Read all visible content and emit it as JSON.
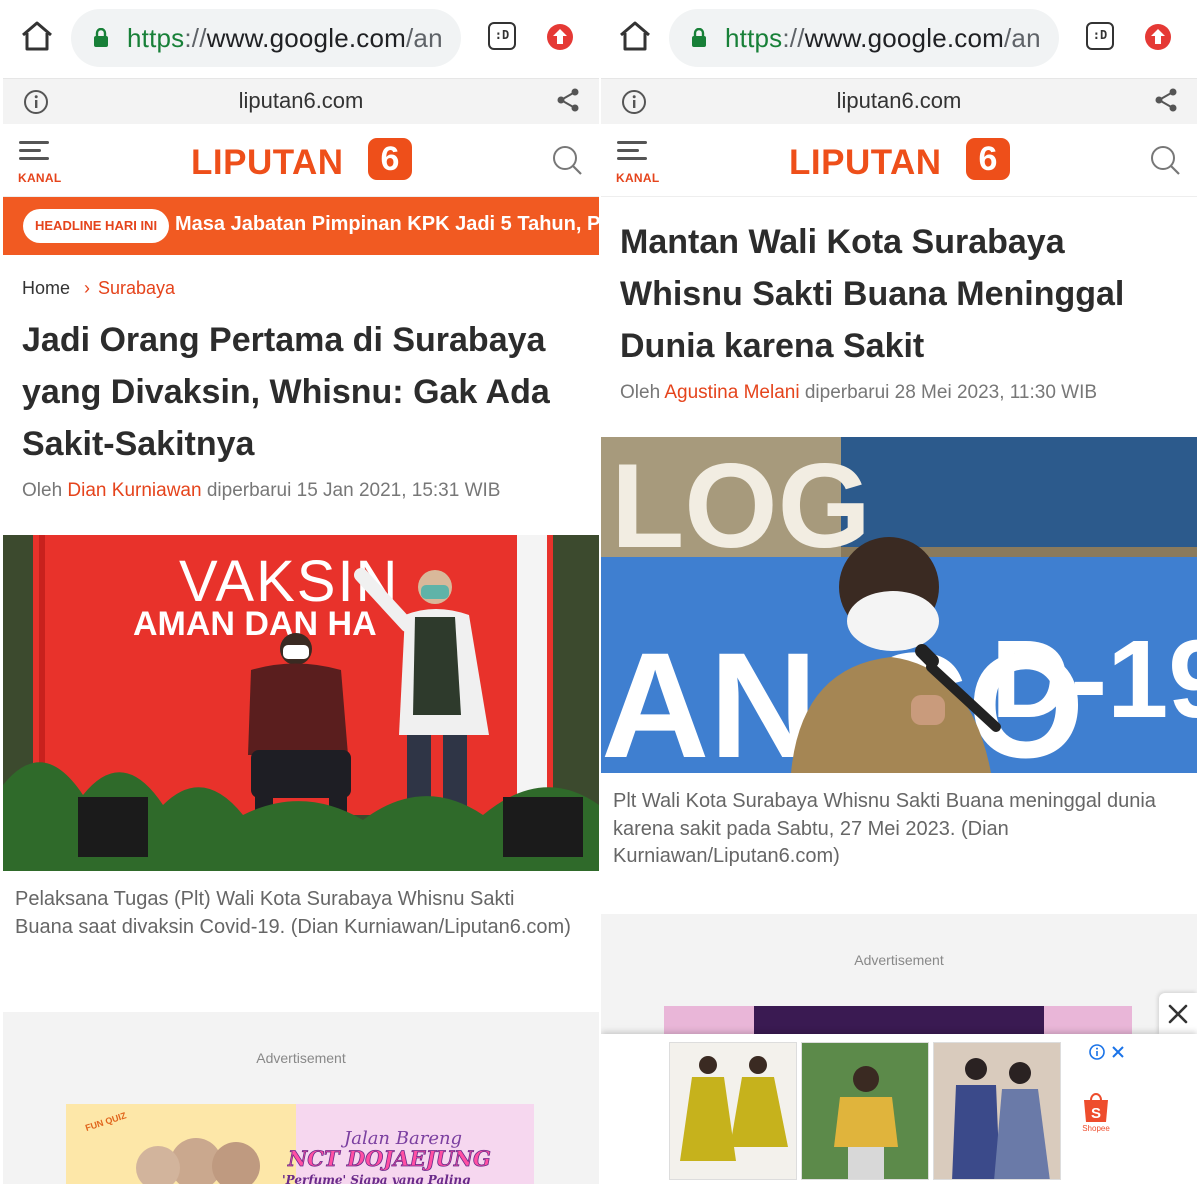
{
  "colors": {
    "brand": "#ee4f1a",
    "url_scheme": "#188038",
    "headline_strip": "#f15a22"
  },
  "left": {
    "browser": {
      "url_scheme": "https",
      "url_sep": "://",
      "url_host": "www.google.com",
      "url_rest": "/an",
      "tab_icon_label": ":D",
      "site_domain": "liputan6.com"
    },
    "header": {
      "menu_label": "KANAL",
      "logo_text": "LIPUTAN",
      "logo_badge": "6"
    },
    "headline": {
      "badge": "HEADLINE HARI INI",
      "text": "Masa Jabatan Pimpinan KPK Jadi 5 Tahun, P"
    },
    "breadcrumb": {
      "home": "Home",
      "separator": "›",
      "category": "Surabaya"
    },
    "article": {
      "title": "Jadi Orang Pertama di Surabaya yang Divaksin, Whisnu: Gak Ada Sakit-Sakitnya",
      "by_prefix": "Oleh",
      "author": "Dian Kurniawan",
      "updated": "diperbarui 15 Jan 2021, 15:31 WIB",
      "photo_banner_1": "VAKSIN",
      "photo_banner_2": "AMAN DAN HA",
      "caption": "Pelaksana Tugas (Plt) Wali Kota Surabaya Whisnu Sakti Buana saat divaksin Covid-19. (Dian Kurniawan/Liputan6.com)"
    },
    "ad": {
      "label": "Advertisement",
      "banner_line1": "Jalan Bareng",
      "banner_line2": "NCT DOJAEJUNG",
      "banner_line3": "'Perfume' Siapa yang Paling",
      "banner_badge": "FUN QUIZ"
    }
  },
  "right": {
    "browser": {
      "url_scheme": "https",
      "url_sep": "://",
      "url_host": "www.google.com",
      "url_rest": "/an",
      "tab_icon_label": ":D",
      "site_domain": "liputan6.com"
    },
    "header": {
      "menu_label": "KANAL",
      "logo_text": "LIPUTAN",
      "logo_badge": "6"
    },
    "article": {
      "title": "Mantan Wali Kota Surabaya Whisnu Sakti Buana Meninggal Dunia karena Sakit",
      "by_prefix": "Oleh",
      "author": "Agustina Melani",
      "updated": "diperbarui 28 Mei 2023, 11:30 WIB",
      "photo_text_1": "LOG",
      "photo_text_2": "AN CO",
      "photo_text_3": "D-19",
      "caption": "Plt Wali Kota Surabaya Whisnu Sakti Buana meninggal dunia karena sakit pada Sabtu, 27 Mei 2023. (Dian Kurniawan/Liputan6.com)"
    },
    "ad": {
      "label": "Advertisement",
      "shopee_label": "Shopee"
    }
  }
}
